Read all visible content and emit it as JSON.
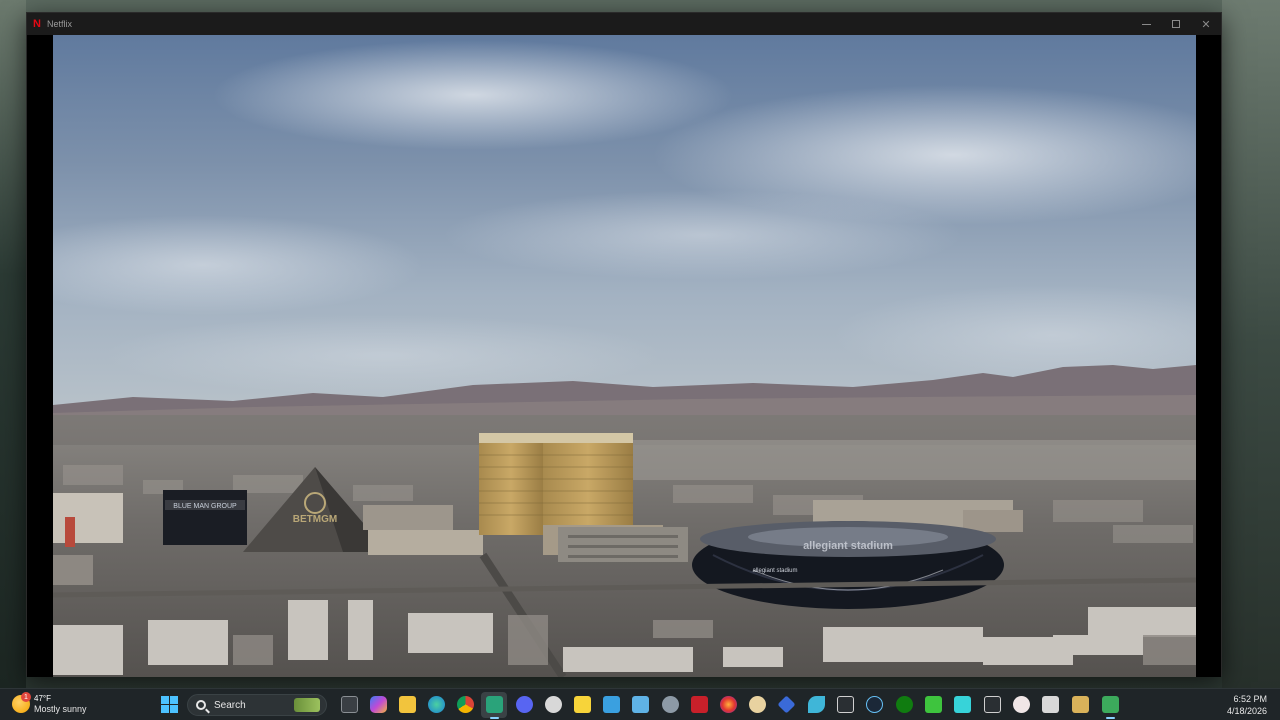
{
  "window": {
    "title": "Netflix",
    "app_icon": "netflix-n-icon"
  },
  "video": {
    "signs": {
      "sphere_banner": "BLUE MAN GROUP",
      "pyramid": "BETMGM",
      "stadium_roof": "allegiant stadium",
      "stadium_side": "allegiant stadium"
    }
  },
  "taskbar": {
    "weather": {
      "temp": "47°F",
      "desc": "Mostly sunny",
      "badge": "1"
    },
    "search": {
      "label": "Search"
    },
    "icons": [
      "task-view-icon",
      "copilot-icon",
      "file-explorer-icon",
      "edge-icon",
      "chrome-icon",
      "active-app-icon",
      "discord-icon",
      "steam-settings-icon",
      "sticky-notes-icon",
      "photos-icon",
      "control-panel-icon",
      "settings-gear-icon",
      "lol-client-icon",
      "firefox-icon",
      "feather-icon",
      "vpn-icon",
      "wing-icon",
      "jupyter-icon",
      "steam-icon",
      "xbox-icon",
      "battery-icon",
      "yeti-icon",
      "y-icon",
      "baseball-icon",
      "keyboard-icon",
      "sticker-icon",
      "green-app-icon"
    ],
    "clock": {
      "time": "6:52 PM",
      "date": "4/18/2026"
    }
  }
}
